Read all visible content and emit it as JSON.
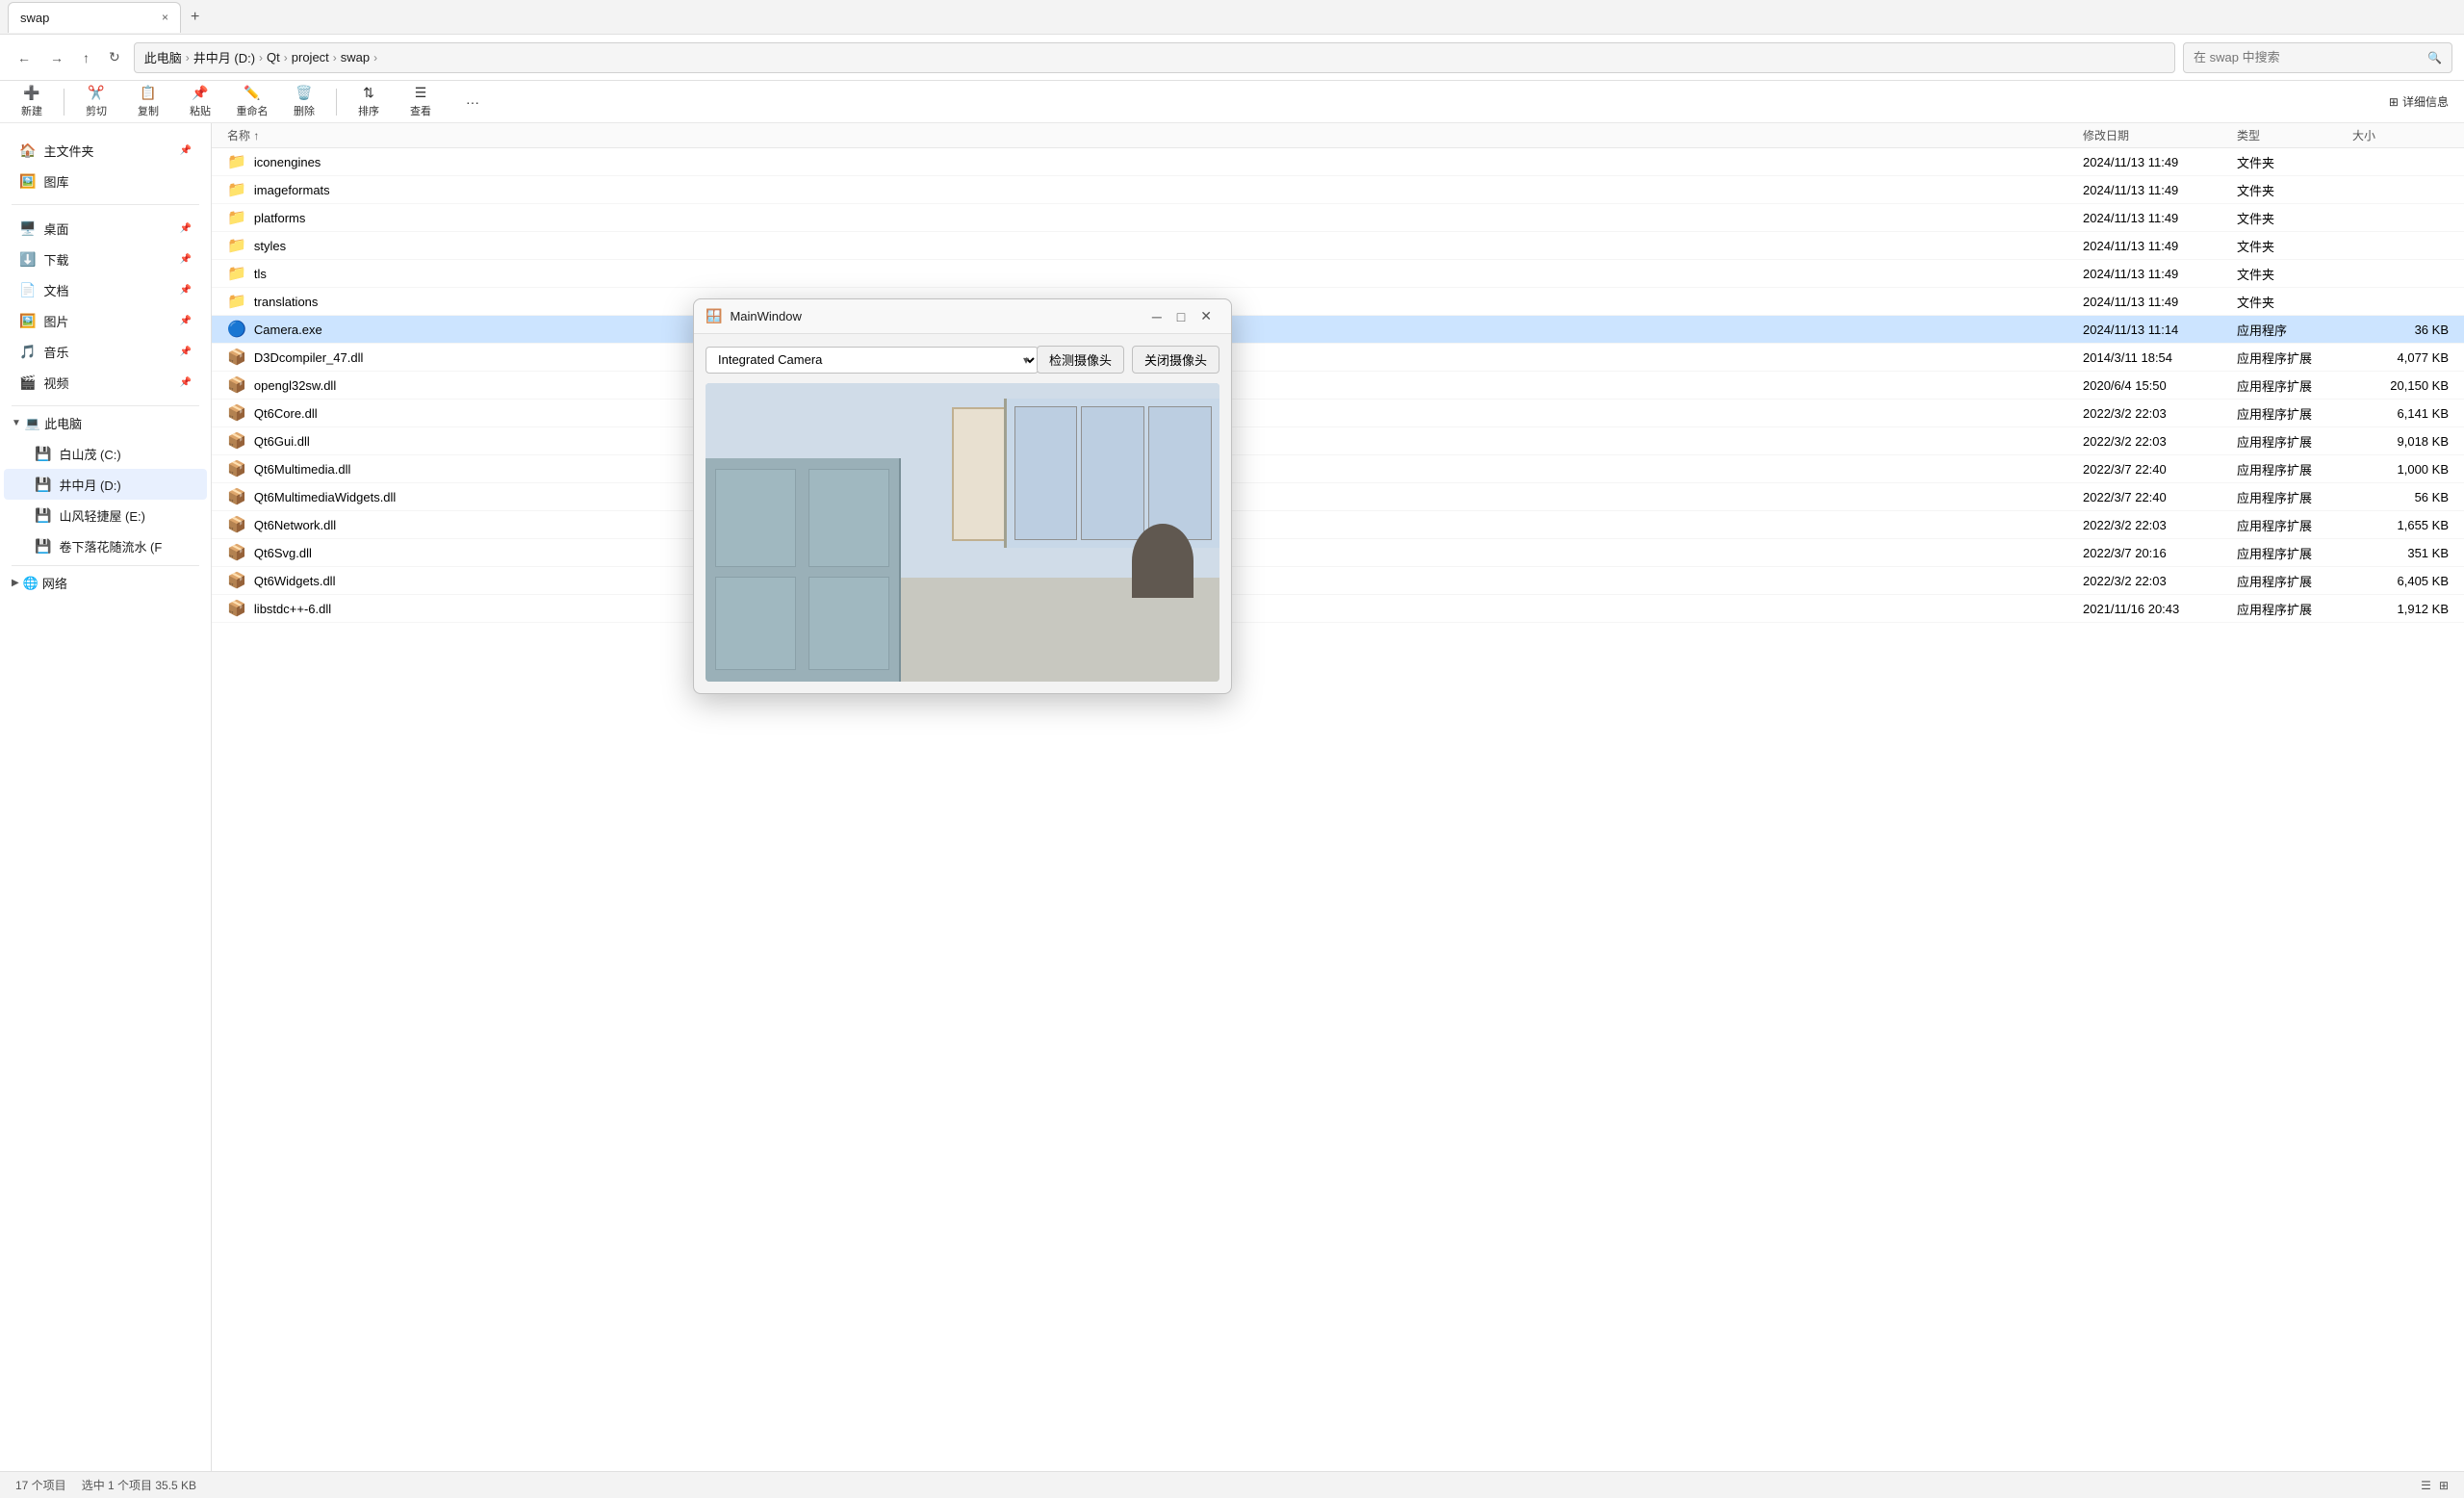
{
  "tab": {
    "title": "swap",
    "close_label": "×",
    "new_label": "+"
  },
  "nav": {
    "back_label": "←",
    "forward_label": "→",
    "up_label": "↑",
    "refresh_label": "↻",
    "breadcrumb": [
      "此电脑",
      "井中月 (D:)",
      "Qt",
      "project",
      "swap"
    ],
    "search_placeholder": "在 swap 中搜索"
  },
  "toolbar": {
    "new_label": "新建",
    "cut_label": "剪切",
    "copy_label": "复制",
    "paste_label": "粘贴",
    "rename_label": "重命名",
    "delete_label": "删除",
    "sort_label": "排序",
    "view_label": "查看",
    "more_label": "···",
    "detail_label": "详细信息"
  },
  "sidebar": {
    "items": [
      {
        "id": "home",
        "label": "主文件夹",
        "icon": "🏠",
        "pinned": true
      },
      {
        "id": "gallery",
        "label": "图库",
        "icon": "🖼️",
        "pinned": false
      },
      {
        "id": "desktop",
        "label": "桌面",
        "icon": "🖥️",
        "pinned": true
      },
      {
        "id": "downloads",
        "label": "下载",
        "icon": "⬇️",
        "pinned": true
      },
      {
        "id": "documents",
        "label": "文档",
        "icon": "📄",
        "pinned": true
      },
      {
        "id": "pictures",
        "label": "图片",
        "icon": "🖼️",
        "pinned": true
      },
      {
        "id": "music",
        "label": "音乐",
        "icon": "🎵",
        "pinned": true
      },
      {
        "id": "videos",
        "label": "视频",
        "icon": "🎬",
        "pinned": true
      }
    ],
    "groups": [
      {
        "id": "this-pc",
        "label": "此电脑",
        "expanded": true,
        "icon": "💻",
        "children": [
          {
            "id": "c-drive",
            "label": "白山茂 (C:)",
            "icon": "💾"
          },
          {
            "id": "d-drive",
            "label": "井中月 (D:)",
            "icon": "💾",
            "active": true
          },
          {
            "id": "e-drive",
            "label": "山风轻捷屋 (E:)",
            "icon": "💾"
          },
          {
            "id": "f-drive",
            "label": "卷下落花随流水 (F",
            "icon": "💾"
          }
        ]
      },
      {
        "id": "network",
        "label": "网络",
        "expanded": false,
        "icon": "🌐"
      }
    ]
  },
  "file_list": {
    "columns": [
      "名称",
      "修改日期",
      "类型",
      "大小"
    ],
    "files": [
      {
        "name": "iconengines",
        "date": "2024/11/13 11:49",
        "type": "文件夹",
        "size": "",
        "icon": "folder"
      },
      {
        "name": "imageformats",
        "date": "2024/11/13 11:49",
        "type": "文件夹",
        "size": "",
        "icon": "folder"
      },
      {
        "name": "platforms",
        "date": "2024/11/13 11:49",
        "type": "文件夹",
        "size": "",
        "icon": "folder"
      },
      {
        "name": "styles",
        "date": "2024/11/13 11:49",
        "type": "文件夹",
        "size": "",
        "icon": "folder"
      },
      {
        "name": "tls",
        "date": "2024/11/13 11:49",
        "type": "文件夹",
        "size": "",
        "icon": "folder"
      },
      {
        "name": "translations",
        "date": "2024/11/13 11:49",
        "type": "文件夹",
        "size": "",
        "icon": "folder"
      },
      {
        "name": "Camera.exe",
        "date": "2024/11/13 11:14",
        "type": "应用程序",
        "size": "36 KB",
        "icon": "exe",
        "selected": true
      },
      {
        "name": "D3Dcompiler_47.dll",
        "date": "2014/3/11 18:54",
        "type": "应用程序扩展",
        "size": "4,077 KB",
        "icon": "dll"
      },
      {
        "name": "opengl32sw.dll",
        "date": "2020/6/4 15:50",
        "type": "应用程序扩展",
        "size": "20,150 KB",
        "icon": "dll"
      },
      {
        "name": "Qt6Core.dll",
        "date": "2022/3/2 22:03",
        "type": "应用程序扩展",
        "size": "6,141 KB",
        "icon": "dll"
      },
      {
        "name": "Qt6Gui.dll",
        "date": "2022/3/2 22:03",
        "type": "应用程序扩展",
        "size": "9,018 KB",
        "icon": "dll"
      },
      {
        "name": "Qt6Multimedia.dll",
        "date": "2022/3/7 22:40",
        "type": "应用程序扩展",
        "size": "1,000 KB",
        "icon": "dll"
      },
      {
        "name": "Qt6MultimediaWidgets.dll",
        "date": "2022/3/7 22:40",
        "type": "应用程序扩展",
        "size": "56 KB",
        "icon": "dll"
      },
      {
        "name": "Qt6Network.dll",
        "date": "2022/3/2 22:03",
        "type": "应用程序扩展",
        "size": "1,655 KB",
        "icon": "dll"
      },
      {
        "name": "Qt6Svg.dll",
        "date": "2022/3/7 20:16",
        "type": "应用程序扩展",
        "size": "351 KB",
        "icon": "dll"
      },
      {
        "name": "Qt6Widgets.dll",
        "date": "2022/3/2 22:03",
        "type": "应用程序扩展",
        "size": "6,405 KB",
        "icon": "dll"
      },
      {
        "name": "libstdc++-6.dll",
        "date": "2021/11/16 20:43",
        "type": "应用程序扩展",
        "size": "1,912 KB",
        "icon": "dll"
      }
    ]
  },
  "status_bar": {
    "item_count": "17 个项目",
    "selected_info": "选中 1 个项目  35.5 KB"
  },
  "popup": {
    "title": "MainWindow",
    "camera_option": "Integrated Camera",
    "detect_btn": "检测摄像头",
    "close_camera_btn": "关闭摄像头",
    "min_label": "─",
    "max_label": "□",
    "close_label": "✕"
  }
}
